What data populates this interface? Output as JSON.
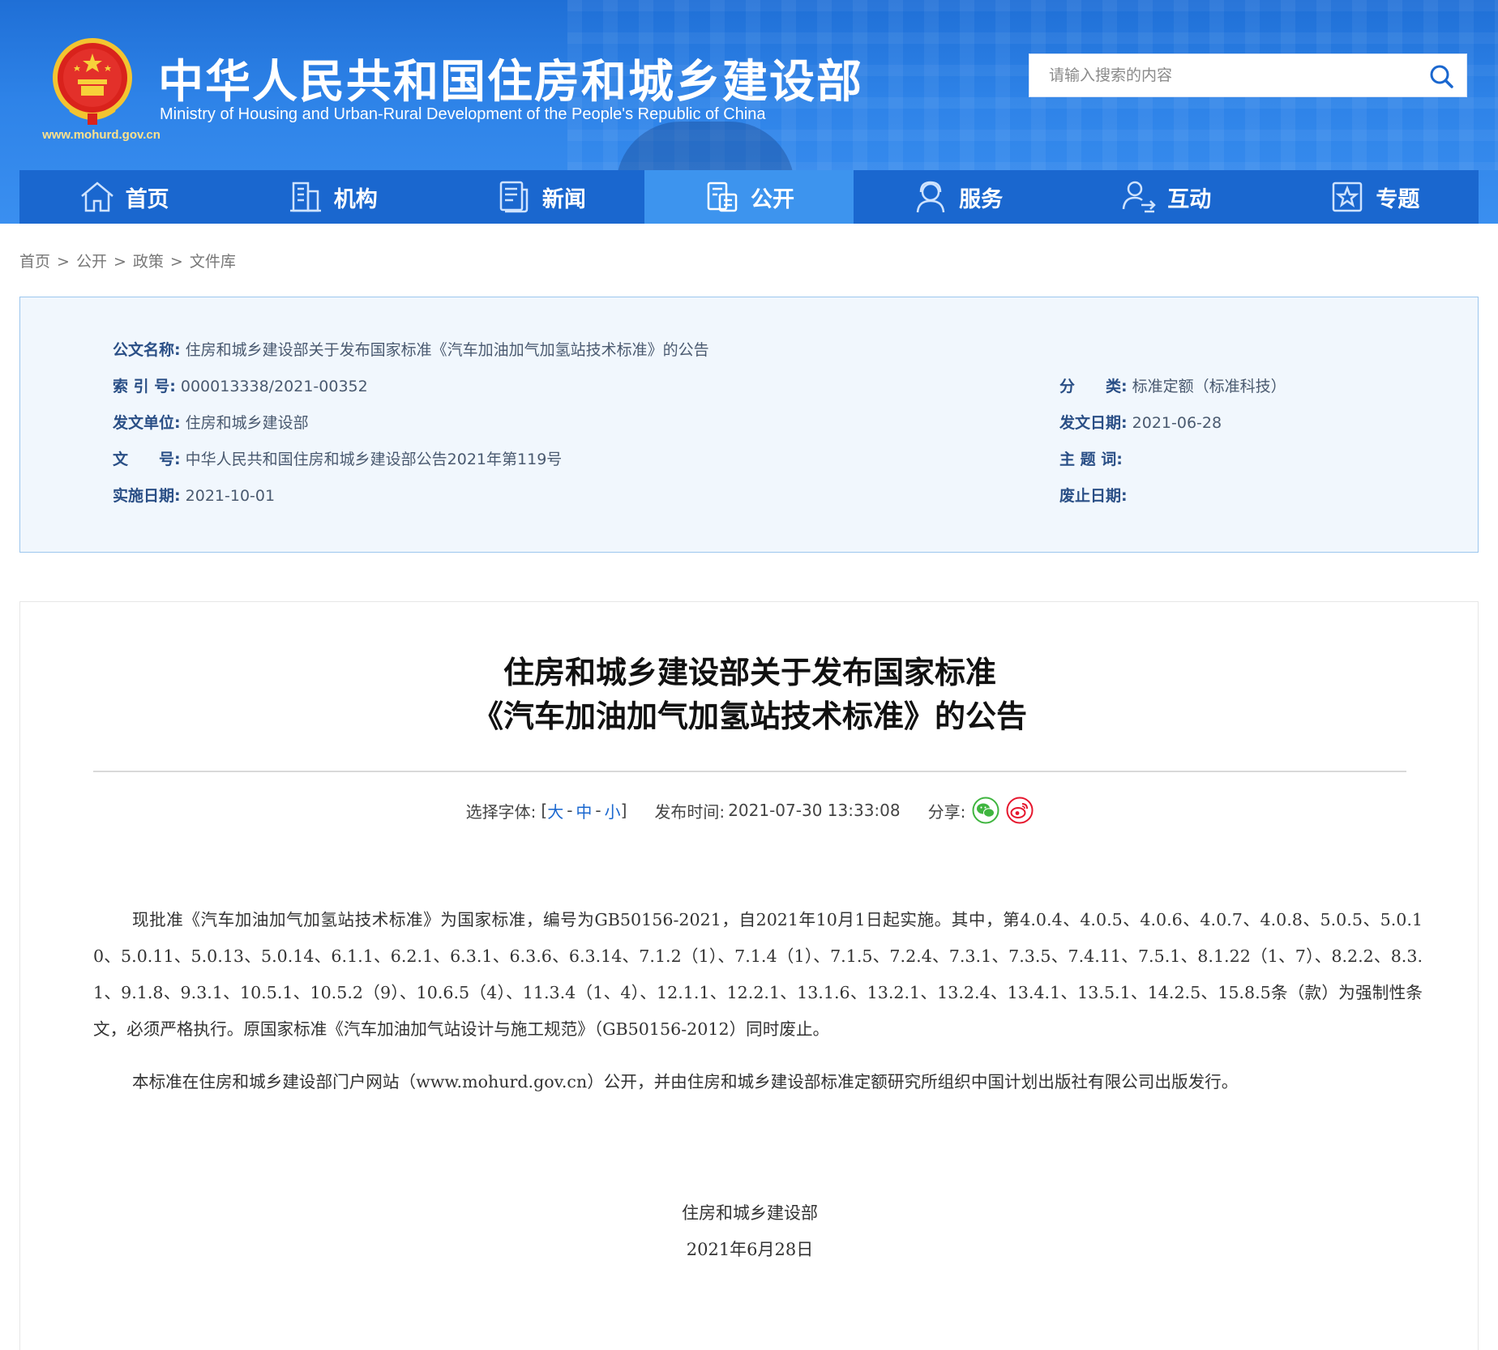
{
  "header": {
    "title": "中华人民共和国住房和城乡建设部",
    "subtitle": "Ministry of Housing and Urban-Rural Development of the People's Republic of China",
    "site_url": "www.mohurd.gov.cn",
    "search_placeholder": "请输入搜索的内容"
  },
  "nav": {
    "items": [
      {
        "label": "首页",
        "icon": "home-icon"
      },
      {
        "label": "机构",
        "icon": "building-icon"
      },
      {
        "label": "新闻",
        "icon": "news-icon"
      },
      {
        "label": "公开",
        "icon": "disclosure-icon"
      },
      {
        "label": "服务",
        "icon": "service-icon"
      },
      {
        "label": "互动",
        "icon": "interaction-icon"
      },
      {
        "label": "专题",
        "icon": "topic-star-icon"
      }
    ],
    "active": "公开"
  },
  "breadcrumb": {
    "items": [
      "首页",
      "公开",
      "政策",
      "文件库"
    ],
    "separator": ">"
  },
  "meta": {
    "doc_name_label": "公文名称:",
    "doc_name": "住房和城乡建设部关于发布国家标准《汽车加油加气加氢站技术标准》的公告",
    "index_label": "索 引 号:",
    "index": "000013338/2021-00352",
    "category_label": "分　　类:",
    "category": "标准定额（标准科技）",
    "issuer_label": "发文单位:",
    "issuer": "住房和城乡建设部",
    "issue_date_label": "发文日期:",
    "issue_date": "2021-06-28",
    "doc_no_label": "文　　号:",
    "doc_no": "中华人民共和国住房和城乡建设部公告2021年第119号",
    "subject_label": "主 题 词:",
    "subject": "",
    "effective_label": "实施日期:",
    "effective": "2021-10-01",
    "abolish_label": "废止日期:",
    "abolish": ""
  },
  "article": {
    "title_line1": "住房和城乡建设部关于发布国家标准",
    "title_line2": "《汽车加油加气加氢站技术标准》的公告",
    "font_select_label": "选择字体:",
    "font_open": "[",
    "font_large": "大",
    "font_medium": "中",
    "font_small": "小",
    "font_close": "]",
    "font_dash": "-",
    "publish_label": "发布时间:",
    "publish_time": "2021-07-30 13:33:08",
    "share_label": "分享:",
    "para1": "现批准《汽车加油加气加氢站技术标准》为国家标准，编号为GB50156-2021，自2021年10月1日起实施。其中，第4.0.4、4.0.5、4.0.6、4.0.7、4.0.8、5.0.5、5.0.10、5.0.11、5.0.13、5.0.14、6.1.1、6.2.1、6.3.1、6.3.6、6.3.14、7.1.2（1）、7.1.4（1）、7.1.5、7.2.4、7.3.1、7.3.5、7.4.11、7.5.1、8.1.22（1、7）、8.2.2、8.3.1、9.1.8、9.3.1、10.5.1、10.5.2（9）、10.6.5（4）、11.3.4（1、4）、12.1.1、12.2.1、13.1.6、13.2.1、13.2.4、13.4.1、13.5.1、14.2.5、15.8.5条（款）为强制性条文，必须严格执行。原国家标准《汽车加油加气站设计与施工规范》（GB50156-2012）同时废止。",
    "para2": "本标准在住房和城乡建设部门户网站（www.mohurd.gov.cn）公开，并由住房和城乡建设部标准定额研究所组织中国计划出版社有限公司出版发行。",
    "sign_org": "住房和城乡建设部",
    "sign_date": "2021年6月28日"
  },
  "colors": {
    "header_blue": "#2e83e8",
    "nav_blue": "#1a67cf",
    "nav_active": "#3d94ee",
    "meta_bg": "#f1f7fd",
    "meta_border": "#9cc6ee",
    "wechat_green": "#3fb53f",
    "weibo_red": "#e6162d"
  }
}
